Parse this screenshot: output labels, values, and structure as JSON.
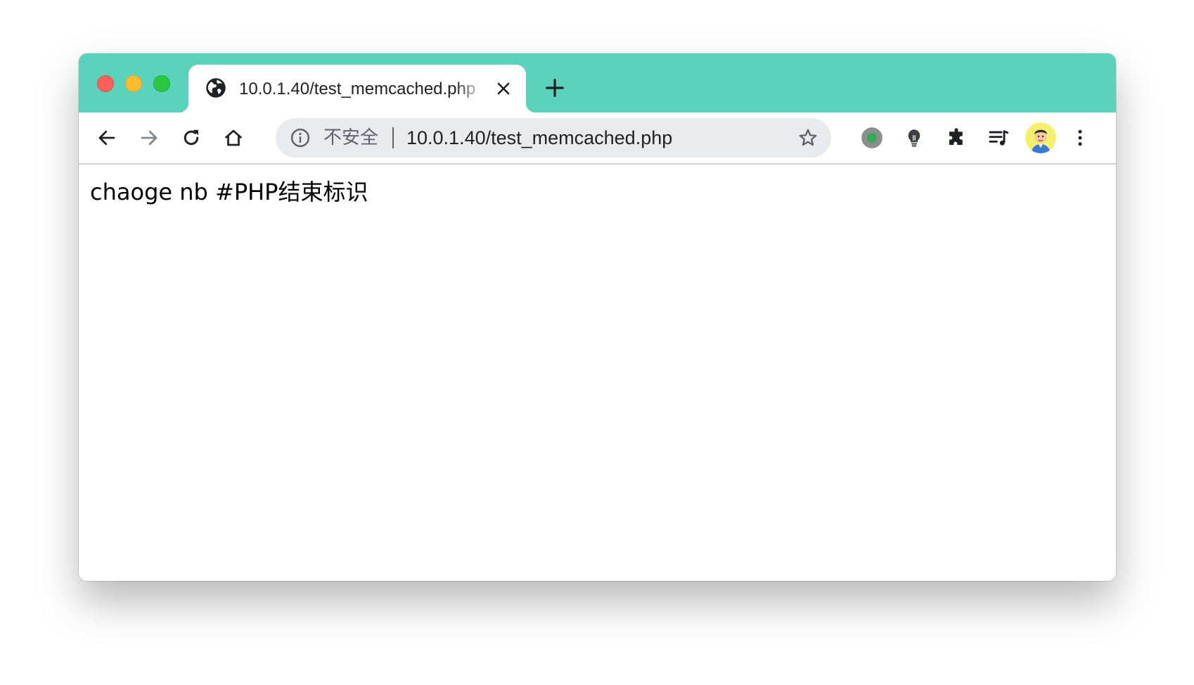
{
  "window": {
    "controls": {
      "close_color": "#fe5f57",
      "minimize_color": "#febc2e",
      "maximize_color": "#28c840"
    },
    "frame_color": "#5bd2bb"
  },
  "tab": {
    "title": "10.0.1.40/test_memcached.php",
    "favicon": "globe-icon",
    "close_icon": "close-icon"
  },
  "newtab_icon": "plus-icon",
  "toolbar": {
    "back_icon": "arrow-left-icon",
    "forward_icon": "arrow-right-icon",
    "reload_icon": "reload-icon",
    "home_icon": "home-icon",
    "omnibox": {
      "security_icon": "info-icon",
      "security_label": "不安全",
      "url": "10.0.1.40/test_memcached.php",
      "bookmark_icon": "star-icon"
    },
    "extensions": [
      {
        "name": "green-dot-extension-icon",
        "color": "#34a853"
      },
      {
        "name": "lightbulb-extension-icon"
      },
      {
        "name": "puzzle-icon"
      },
      {
        "name": "media-queue-icon"
      }
    ],
    "avatar": "avatar-icon",
    "menu_icon": "kebab-menu-icon"
  },
  "page": {
    "body_text": "chaoge nb #PHP结束标识"
  }
}
